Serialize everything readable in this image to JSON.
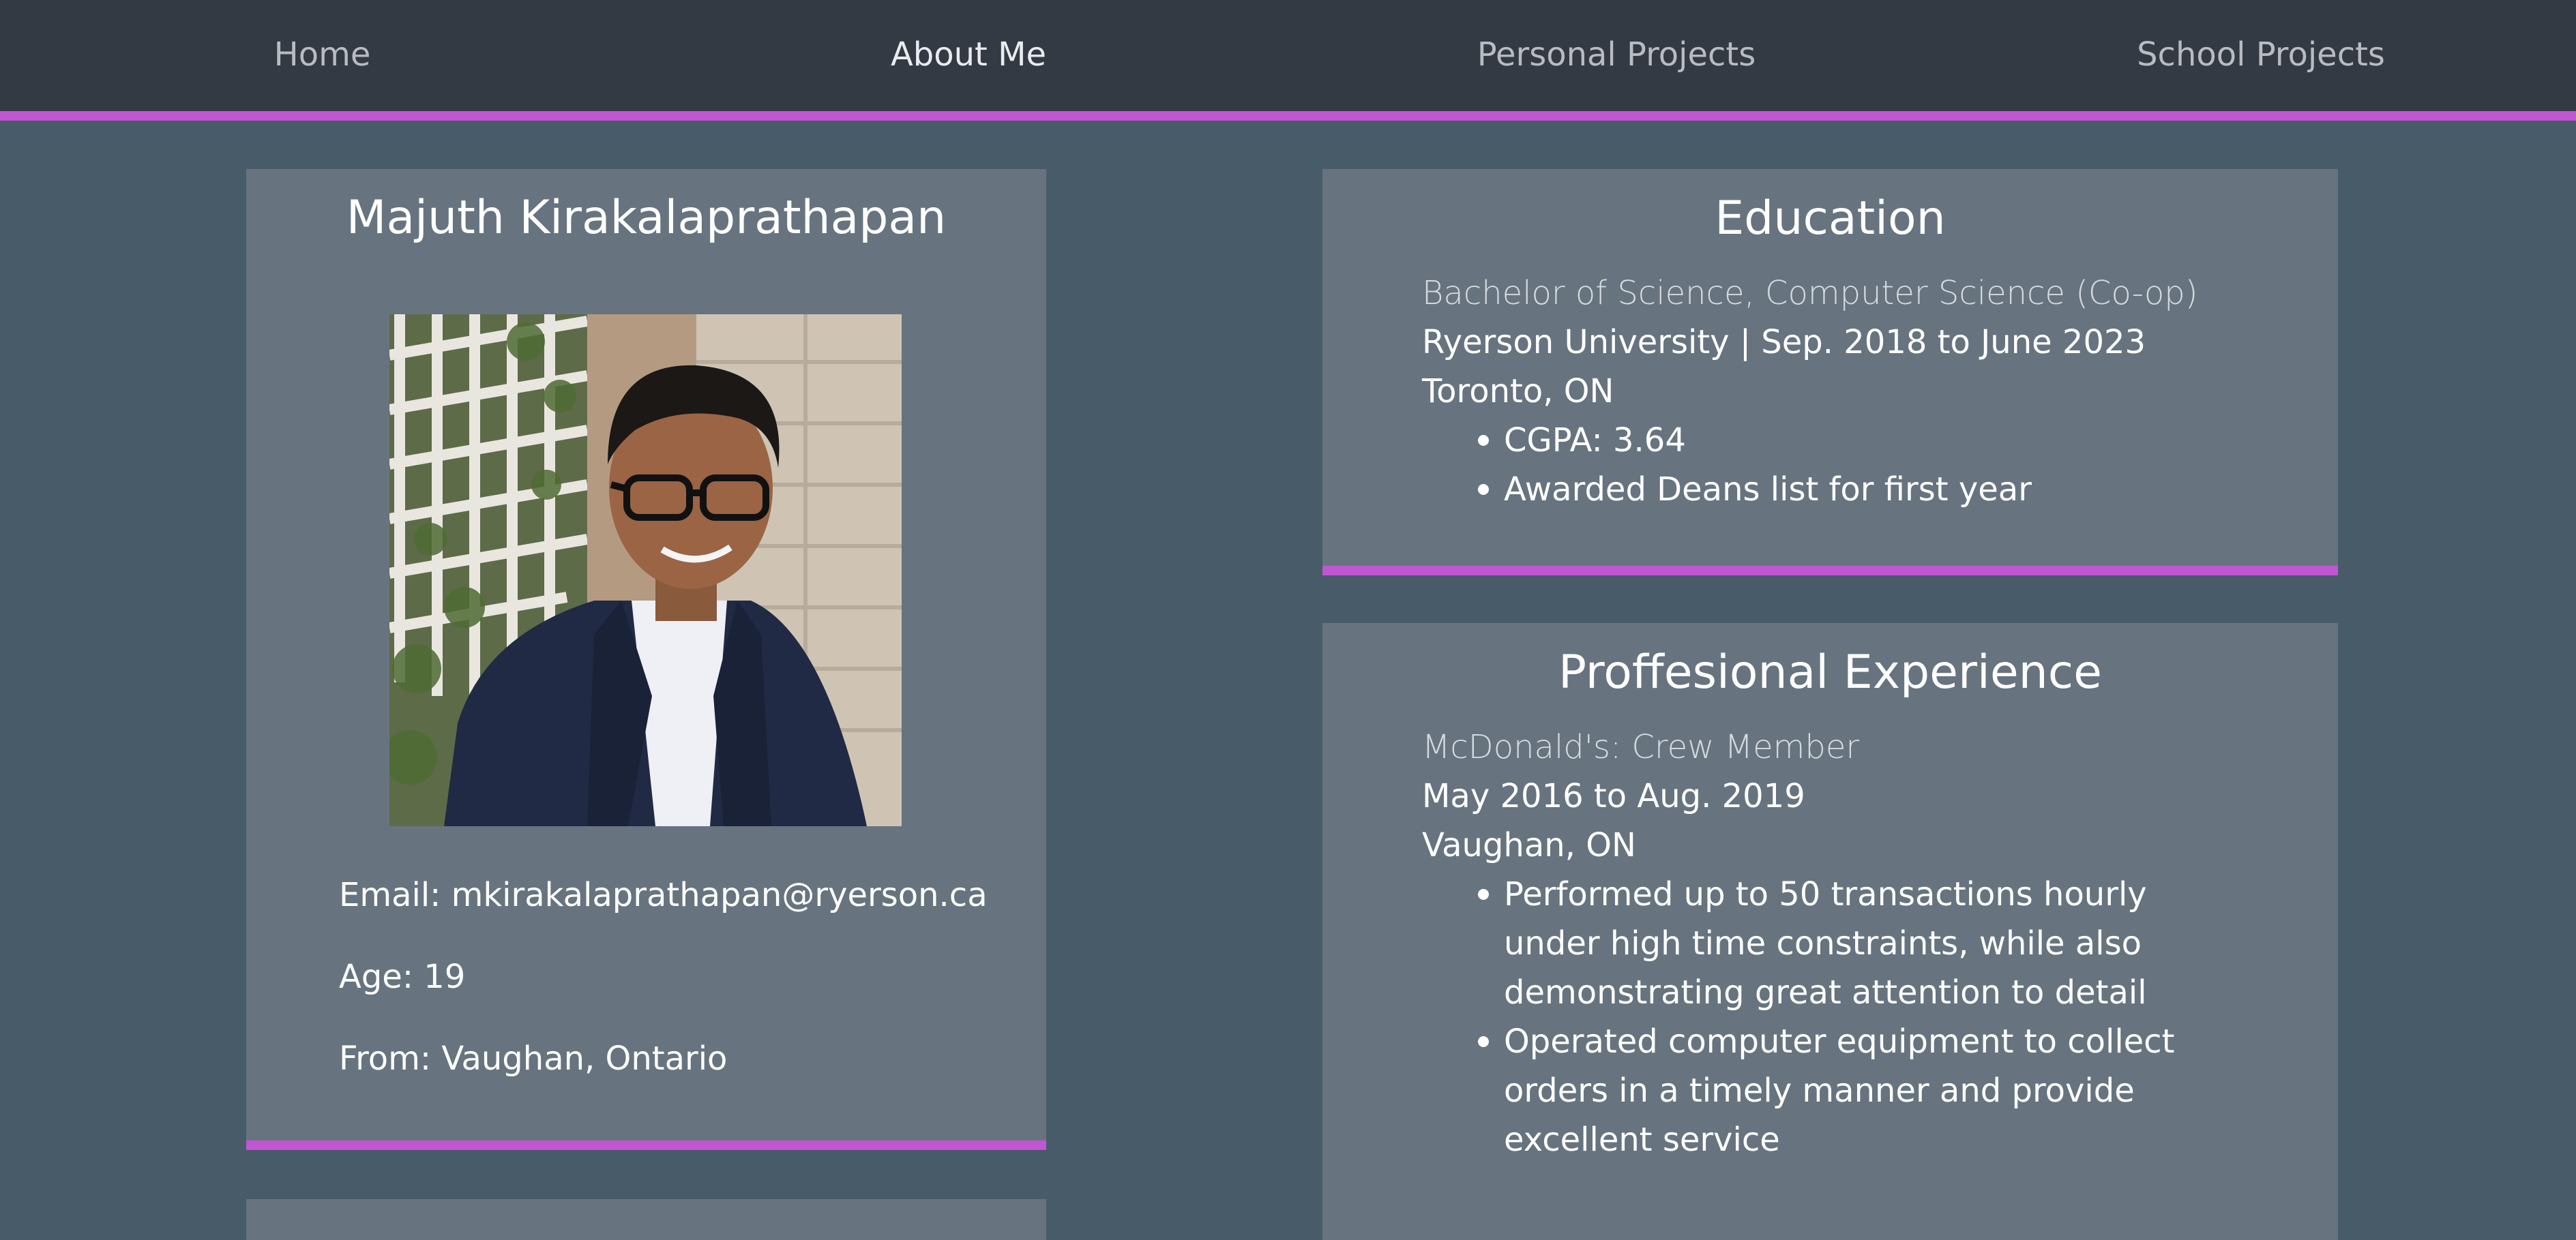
{
  "nav": {
    "items": [
      {
        "label": "Home"
      },
      {
        "label": "About Me"
      },
      {
        "label": "Personal Projects"
      },
      {
        "label": "School Projects"
      }
    ]
  },
  "colors": {
    "background": "#475b68",
    "navbar": "#343a43",
    "card": "#67747f",
    "accent": "#c155d3"
  },
  "profile": {
    "name": "Majuth Kirakalaprathapan",
    "photo_icon": "profile-photo",
    "email": "Email: mkirakalaprathapan@ryerson.ca",
    "age": "Age: 19",
    "from": "From: Vaughan, Ontario"
  },
  "education": {
    "title": "Education",
    "degree": "Bachelor of Science, Computer Science (Co-op)",
    "school_dates": "Ryerson University | Sep. 2018 to June 2023",
    "location": "Toronto, ON",
    "bullets": [
      "CGPA: 3.64",
      "Awarded Deans list for first year"
    ]
  },
  "experience": {
    "title": "Proffesional Experience",
    "role": "McDonald's: Crew Member",
    "dates": "May 2016 to Aug. 2019",
    "location": "Vaughan, ON",
    "bullets": [
      "Performed up to 50 transactions hourly under high time constraints, while also demonstrating great attention to detail",
      "Operated computer equipment to collect orders in a timely manner and provide excellent service"
    ]
  }
}
